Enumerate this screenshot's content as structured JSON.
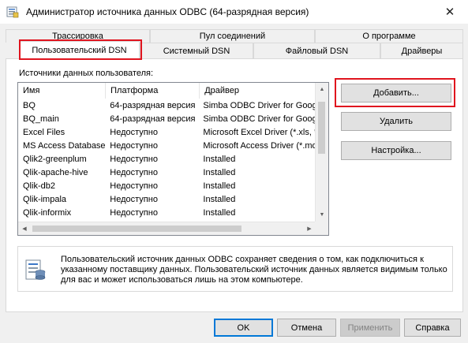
{
  "window": {
    "title": "Администратор источника данных ODBC (64-разрядная версия)",
    "close_glyph": "✕"
  },
  "tabs": {
    "row1": [
      {
        "label": "Трассировка"
      },
      {
        "label": "Пул соединений"
      },
      {
        "label": "О программе"
      }
    ],
    "row2": [
      {
        "label": "Пользовательский DSN",
        "active": true
      },
      {
        "label": "Системный DSN"
      },
      {
        "label": "Файловый DSN"
      },
      {
        "label": "Драйверы"
      }
    ]
  },
  "panel": {
    "section_label": "Источники данных пользователя:",
    "columns": [
      "Имя",
      "Платформа",
      "Драйвер"
    ],
    "rows": [
      [
        "BQ",
        "64-разрядная версия",
        "Simba ODBC Driver for Google"
      ],
      [
        "BQ_main",
        "64-разрядная версия",
        "Simba ODBC Driver for Google"
      ],
      [
        "Excel Files",
        "Недоступно",
        "Microsoft Excel Driver (*.xls, *."
      ],
      [
        "MS Access Database",
        "Недоступно",
        "Microsoft Access Driver (*.mdb"
      ],
      [
        "Qlik2-greenplum",
        "Недоступно",
        "Installed"
      ],
      [
        "Qlik-apache-hive",
        "Недоступно",
        "Installed"
      ],
      [
        "Qlik-db2",
        "Недоступно",
        "Installed"
      ],
      [
        "Qlik-impala",
        "Недоступно",
        "Installed"
      ],
      [
        "Qlik-informix",
        "Недоступно",
        "Installed"
      ]
    ],
    "buttons": {
      "add": "Добавить...",
      "remove": "Удалить",
      "configure": "Настройка..."
    },
    "info_text": "Пользовательский источник данных ODBC сохраняет сведения о том, как подключиться к указанному поставщику данных.   Пользовательский источник данных является видимым только для вас и может использоваться лишь на этом компьютере."
  },
  "footer": {
    "ok": "OK",
    "cancel": "Отмена",
    "apply": "Применить",
    "help": "Справка"
  },
  "colors": {
    "highlight": "#e0141e",
    "focus": "#0078d7"
  }
}
